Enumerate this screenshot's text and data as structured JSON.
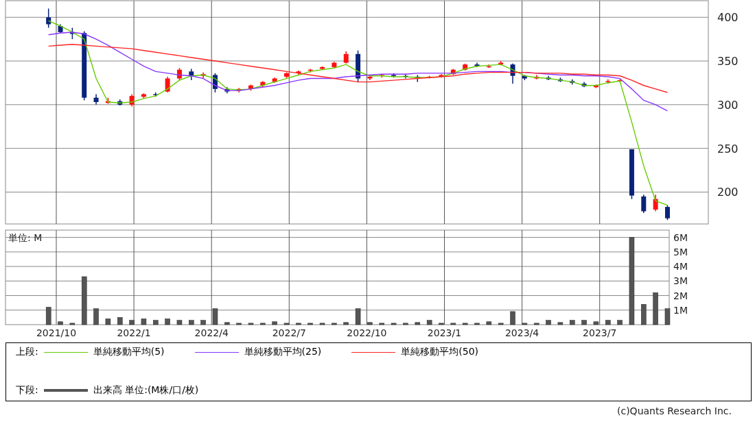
{
  "price_chart": {
    "chart_data": {
      "type": "candlestick",
      "grid": true,
      "ohlc": [
        [
          400,
          410,
          388,
          392
        ],
        [
          390,
          392,
          382,
          383
        ],
        [
          383,
          388,
          375,
          381
        ],
        [
          382,
          384,
          305,
          308
        ],
        [
          308,
          312,
          300,
          303
        ],
        [
          302,
          308,
          301,
          304
        ],
        [
          304,
          306,
          299,
          300
        ],
        [
          300,
          312,
          298,
          310
        ],
        [
          309,
          313,
          307,
          312
        ],
        [
          312,
          314,
          309,
          311
        ],
        [
          315,
          332,
          314,
          330
        ],
        [
          330,
          342,
          328,
          340
        ],
        [
          338,
          341,
          328,
          333
        ],
        [
          333,
          337,
          330,
          335
        ],
        [
          334,
          336,
          314,
          318
        ],
        [
          318,
          320,
          313,
          315
        ],
        [
          316,
          319,
          314,
          318
        ],
        [
          318,
          323,
          316,
          322
        ],
        [
          322,
          327,
          320,
          326
        ],
        [
          326,
          331,
          325,
          330
        ],
        [
          332,
          337,
          330,
          336
        ],
        [
          336,
          339,
          334,
          338
        ],
        [
          339,
          341,
          337,
          340
        ],
        [
          341,
          344,
          340,
          343
        ],
        [
          343,
          349,
          342,
          348
        ],
        [
          348,
          361,
          347,
          358
        ],
        [
          358,
          362,
          326,
          330
        ],
        [
          330,
          334,
          328,
          332
        ],
        [
          333,
          335,
          331,
          334
        ],
        [
          334,
          336,
          331,
          333
        ],
        [
          333,
          335,
          330,
          332
        ],
        [
          332,
          334,
          326,
          331
        ],
        [
          331,
          333,
          330,
          332
        ],
        [
          332,
          335,
          331,
          334
        ],
        [
          335,
          341,
          334,
          340
        ],
        [
          340,
          347,
          339,
          346
        ],
        [
          346,
          348,
          343,
          344
        ],
        [
          344,
          346,
          342,
          344
        ],
        [
          346,
          350,
          345,
          348
        ],
        [
          346,
          347,
          324,
          333
        ],
        [
          333,
          334,
          328,
          330
        ],
        [
          330,
          334,
          329,
          332
        ],
        [
          331,
          333,
          328,
          329
        ],
        [
          329,
          331,
          326,
          327
        ],
        [
          327,
          329,
          323,
          325
        ],
        [
          324,
          326,
          320,
          321
        ],
        [
          320,
          323,
          319,
          322
        ],
        [
          326,
          329,
          324,
          327
        ],
        [
          327,
          329,
          326,
          328
        ],
        [
          249,
          249,
          192,
          196
        ],
        [
          195,
          197,
          176,
          178
        ],
        [
          180,
          197,
          178,
          192
        ],
        [
          183,
          185,
          168,
          170
        ]
      ],
      "categories": [
        null,
        null,
        null,
        null,
        null,
        null,
        null,
        null,
        null,
        null,
        null,
        null,
        null,
        null,
        null,
        null,
        null,
        null,
        null,
        null,
        null,
        null,
        null,
        null,
        null,
        null,
        null,
        null,
        null,
        null,
        null,
        null,
        null,
        null,
        null,
        null,
        null,
        null,
        null,
        null,
        null,
        null,
        null,
        null,
        null,
        null,
        null,
        null,
        null,
        null,
        null,
        null,
        null
      ],
      "ylim": [
        163.5,
        419
      ]
    },
    "moving_averages": {
      "chart_data": {
        "type": "line",
        "grid": true,
        "categories": [
          null,
          null,
          null,
          null,
          null,
          null,
          null,
          null,
          null,
          null,
          null,
          null,
          null,
          null,
          null,
          null,
          null,
          null,
          null,
          null,
          null,
          null,
          null,
          null,
          null,
          null,
          null,
          null,
          null,
          null,
          null,
          null,
          null,
          null,
          null,
          null,
          null,
          null,
          null,
          null,
          null,
          null,
          null,
          null,
          null,
          null,
          null,
          null,
          null,
          null,
          null,
          null,
          null
        ],
        "series": [
          {
            "name": "単純移動平均(5)",
            "color": "#66cc00",
            "values": [
              396,
              390,
              383,
              375,
              330,
              303,
              302,
              303,
              307,
              310,
              318,
              328,
              333,
              334,
              330,
              318,
              317,
              318,
              322,
              326,
              330,
              334,
              338,
              340,
              342,
              346,
              338,
              333,
              333,
              332,
              332,
              331,
              331,
              332,
              336,
              341,
              344,
              345,
              346,
              340,
              333,
              331,
              330,
              328,
              326,
              322,
              322,
              325,
              327,
              280,
              230,
              190,
              185
            ]
          },
          {
            "name": "単純移動平均(25)",
            "color": "#8833ff",
            "values": [
              380,
              382,
              383,
              381,
              375,
              368,
              360,
              352,
              344,
              338,
              336,
              334,
              333,
              330,
              322,
              316,
              316,
              318,
              320,
              322,
              325,
              328,
              330,
              330,
              330,
              332,
              333,
              334,
              335,
              335,
              335,
              336,
              336,
              336,
              336,
              337,
              338,
              338,
              338,
              337,
              337,
              336,
              335,
              334,
              334,
              333,
              333,
              332,
              330,
              318,
              305,
              300,
              293
            ]
          },
          {
            "name": "単純移動平均(50)",
            "color": "#ff2222",
            "values": [
              367,
              368,
              369,
              368,
              367,
              366,
              365,
              364,
              362,
              360,
              358,
              356,
              354,
              352,
              350,
              348,
              346,
              344,
              342,
              340,
              338,
              336,
              334,
              332,
              330,
              328,
              326,
              326,
              327,
              328,
              329,
              330,
              331,
              332,
              333,
              335,
              336,
              337,
              337,
              337,
              337,
              336,
              336,
              336,
              335,
              335,
              334,
              334,
              333,
              328,
              322,
              318,
              314
            ]
          }
        ],
        "ylim": [
          163.5,
          419
        ],
        "yticks": [
          {
            "value": 200,
            "label": "200"
          },
          {
            "value": 250,
            "label": "250"
          },
          {
            "value": 300,
            "label": "300"
          },
          {
            "value": 350,
            "label": "350"
          },
          {
            "value": 400,
            "label": "400"
          }
        ]
      }
    }
  },
  "volume_chart": {
    "unit_label": "単位: M",
    "date_labels": [
      "2021/10",
      "2022/1",
      "2022/4",
      "2022/7",
      "2022/10",
      "2023/1",
      "2023/4",
      "2023/7"
    ],
    "chart_data": {
      "type": "bar",
      "grid": true,
      "categories": [
        null,
        null,
        null,
        null,
        null,
        null,
        null,
        null,
        null,
        null,
        null,
        null,
        null,
        null,
        null,
        null,
        null,
        null,
        null,
        null,
        null,
        null,
        null,
        null,
        null,
        null,
        null,
        null,
        null,
        null,
        null,
        null,
        null,
        null,
        null,
        null,
        null,
        null,
        null,
        null,
        null,
        null,
        null,
        null,
        null,
        null,
        null,
        null,
        null,
        null,
        null,
        null,
        null
      ],
      "series": [
        {
          "name": "出来高 単位:(M株/口/枚)",
          "color": "#555555",
          "values": [
            1.2,
            0.2,
            0.1,
            3.3,
            1.1,
            0.4,
            0.5,
            0.3,
            0.4,
            0.3,
            0.4,
            0.3,
            0.3,
            0.3,
            1.1,
            0.15,
            0.1,
            0.1,
            0.1,
            0.2,
            0.1,
            0.1,
            0.1,
            0.1,
            0.1,
            0.15,
            1.1,
            0.15,
            0.1,
            0.1,
            0.1,
            0.15,
            0.3,
            0.1,
            0.1,
            0.1,
            0.1,
            0.2,
            0.1,
            0.9,
            0.1,
            0.1,
            0.3,
            0.15,
            0.3,
            0.3,
            0.2,
            0.3,
            0.3,
            6,
            1.4,
            2.2,
            1.1
          ]
        }
      ],
      "ylim": [
        0,
        6.5
      ],
      "yticks": [
        {
          "value": 1,
          "label": "1M"
        },
        {
          "value": 2,
          "label": "2M"
        },
        {
          "value": 3,
          "label": "3M"
        },
        {
          "value": 4,
          "label": "4M"
        },
        {
          "value": 5,
          "label": "5M"
        },
        {
          "value": 6,
          "label": "6M"
        }
      ]
    }
  },
  "legend": {
    "upper_label": "上段:",
    "lower_label": "下段:"
  },
  "copyright": "(c)Quants Research Inc."
}
